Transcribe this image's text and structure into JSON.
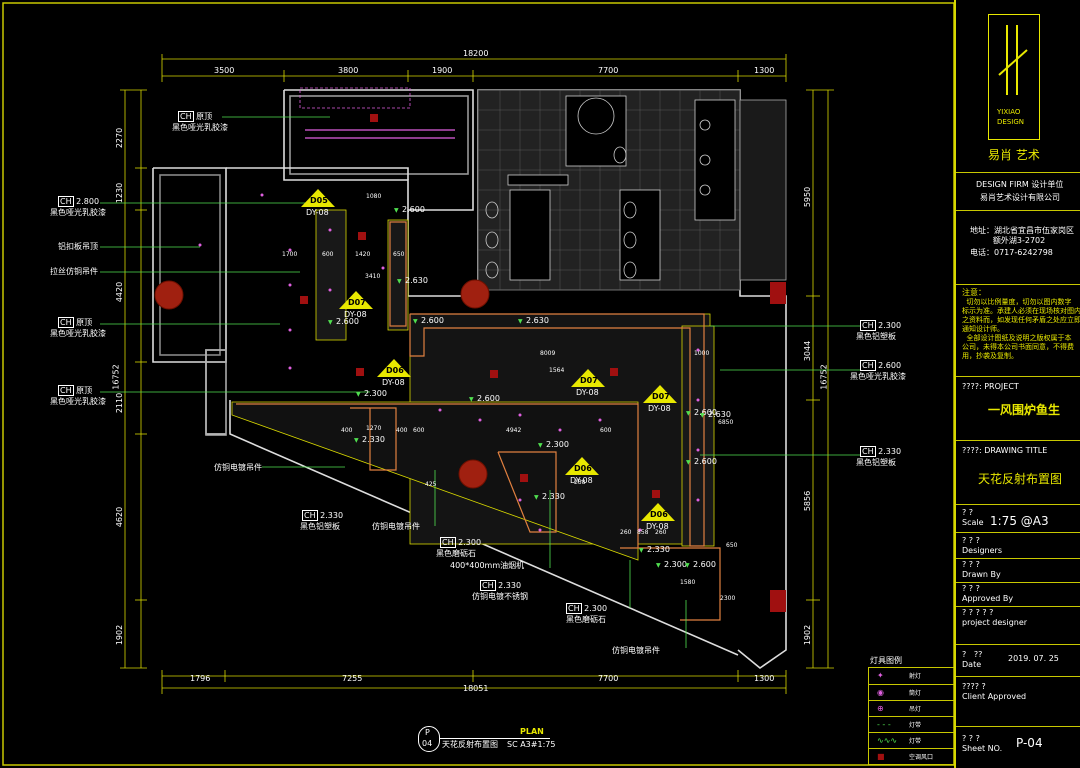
{
  "dimensions": {
    "top": {
      "total": "18200",
      "segs": [
        "3500",
        "3800",
        "1900",
        "7700",
        "1300"
      ]
    },
    "bottom": {
      "total": "18051",
      "segs": [
        "1796",
        "7255",
        "7700",
        "1300"
      ]
    },
    "left": {
      "total": "16752",
      "segs": [
        "2270",
        "1230",
        "4420",
        "2110",
        "4620",
        "1902"
      ]
    },
    "right": {
      "total": "16752",
      "segs": [
        "5950",
        "3044",
        "5856",
        "1902"
      ]
    }
  },
  "annotations": [
    {
      "code": "CH",
      "value": "原顶",
      "desc": "黑色哑光乳胶漆"
    },
    {
      "code": "CH",
      "value": "2.800",
      "desc": "黑色哑光乳胶漆"
    },
    {
      "code": "",
      "value": "铝扣板吊顶",
      "desc": ""
    },
    {
      "code": "",
      "value": "拉丝仿铜吊件",
      "desc": ""
    },
    {
      "code": "CH",
      "value": "原顶",
      "desc": "黑色哑光乳胶漆"
    },
    {
      "code": "CH",
      "value": "原顶",
      "desc": "黑色哑光乳胶漆"
    },
    {
      "code": "",
      "value": "仿铜电镀吊件",
      "desc": ""
    },
    {
      "code": "CH",
      "value": "2.330",
      "desc": "黑色铝塑板"
    },
    {
      "code": "",
      "value": "仿铜电镀吊件",
      "desc": ""
    },
    {
      "code": "CH",
      "value": "2.300",
      "desc": "黑色磨砺石"
    },
    {
      "code": "",
      "value": "400*400mm油烟机",
      "desc": ""
    },
    {
      "code": "CH",
      "value": "2.330",
      "desc": "仿铜电镀不锈钢"
    },
    {
      "code": "CH",
      "value": "2.300",
      "desc": "黑色磨砺石"
    },
    {
      "code": "",
      "value": "仿铜电镀吊件",
      "desc": ""
    },
    {
      "code": "CH",
      "value": "2.300",
      "desc": "黑色铝塑板"
    },
    {
      "code": "CH",
      "value": "2.600",
      "desc": "黑色哑光乳胶漆"
    },
    {
      "code": "CH",
      "value": "2.330",
      "desc": "黑色铝塑板"
    }
  ],
  "tags": [
    {
      "top": "D05",
      "bot": "DY-08"
    },
    {
      "top": "D07",
      "bot": "DY-08"
    },
    {
      "top": "D06",
      "bot": "DY-08"
    },
    {
      "top": "D07",
      "bot": "DY-08"
    },
    {
      "top": "D07",
      "bot": "DY-08"
    },
    {
      "top": "D06",
      "bot": "DY-08"
    },
    {
      "top": "D06",
      "bot": "DY-08"
    }
  ],
  "heights": [
    "2.600",
    "2.630",
    "2.600",
    "2.600",
    "2.630",
    "2.300",
    "2.600",
    "2.600",
    "2.630",
    "2.600",
    "2.300",
    "2.330",
    "2.330",
    "2.330",
    "2.300",
    "2.600"
  ],
  "inner_dims": [
    "1700",
    "600",
    "1420",
    "650",
    "3410",
    "1080",
    "8009",
    "1000",
    "1564",
    "6850",
    "4942",
    "1270",
    "400",
    "400",
    "600",
    "600",
    "425",
    "258",
    "260",
    "858",
    "260",
    "1580",
    "2300",
    "650"
  ],
  "drawing_label": {
    "circle_top": "P",
    "circle_bot": "04",
    "plan": "PLAN",
    "name": "天花反射布置图",
    "scale": "SC A3#1:75"
  },
  "legend": {
    "title": "灯具图例",
    "items": [
      "射灯",
      "筒灯",
      "吊灯",
      "灯带",
      "灯带",
      "空调风口"
    ]
  },
  "title_block": {
    "logo_line1": "YIXIAO",
    "logo_line2": "DESIGN",
    "company_cn": "易肖 艺术",
    "firm_label": "DESIGN FIRM  设计单位",
    "firm_name": "易肖艺术设计有限公司",
    "address": "地址：湖北省宜昌市伍家岗区\n         额外湖3-2702",
    "phone": "电话：0717-6242798",
    "note_title": "注意：",
    "note_text": "  切勿以比例量度，切勿以图内数字\n标示为准。承建人必须在现场核对图内\n之资料而，如发现任何矛盾之处应立即\n通知设计师。\n  全部设计图纸及说明之版权属于本\n公司，未得本公司书面同意，不得费\n用，抄袭及复制。",
    "project_label": "????:        PROJECT",
    "project_name": "一风围炉鱼生",
    "drawing_title_label": "????:     DRAWING TITLE",
    "drawing_title": "天花反射布置图",
    "scale_label": "? ?\nScale",
    "scale_value": "1:75 @A3",
    "designers": "? ? ?\nDesigners",
    "drawn_by": "? ? ?\nDrawn By",
    "approved_by": "? ? ?\nApproved By",
    "project_designer": "? ? ? ? ?\nproject designer",
    "date_label": "?   ??\nDate",
    "date_value": "2019. 07. 25",
    "client_approved": "???? ?\nClient Approved",
    "sheet_label": "? ? ?\nSheet NO.",
    "sheet_value": "P-04"
  }
}
